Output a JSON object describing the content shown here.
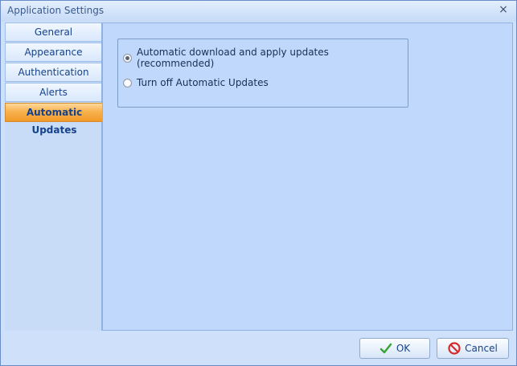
{
  "window": {
    "title": "Application Settings",
    "close_glyph": "×"
  },
  "sidebar": {
    "items": [
      {
        "label": "General"
      },
      {
        "label": "Appearance"
      },
      {
        "label": "Authentication"
      },
      {
        "label": "Alerts"
      },
      {
        "label": "Automatic Updates",
        "selected": true
      }
    ]
  },
  "updates": {
    "options": [
      {
        "label": "Automatic download and apply updates (recommended)",
        "checked": true
      },
      {
        "label": "Turn off Automatic Updates",
        "checked": false
      }
    ]
  },
  "footer": {
    "ok_label": "OK",
    "cancel_label": "Cancel"
  },
  "icons": {
    "ok": "checkmark-icon",
    "cancel": "no-entry-icon",
    "close": "close-icon"
  },
  "colors": {
    "active_tab": "#f29a28",
    "panel_bg": "#bfd8fb",
    "ok_check": "#3aa33a",
    "cancel_red": "#d42a2a"
  }
}
